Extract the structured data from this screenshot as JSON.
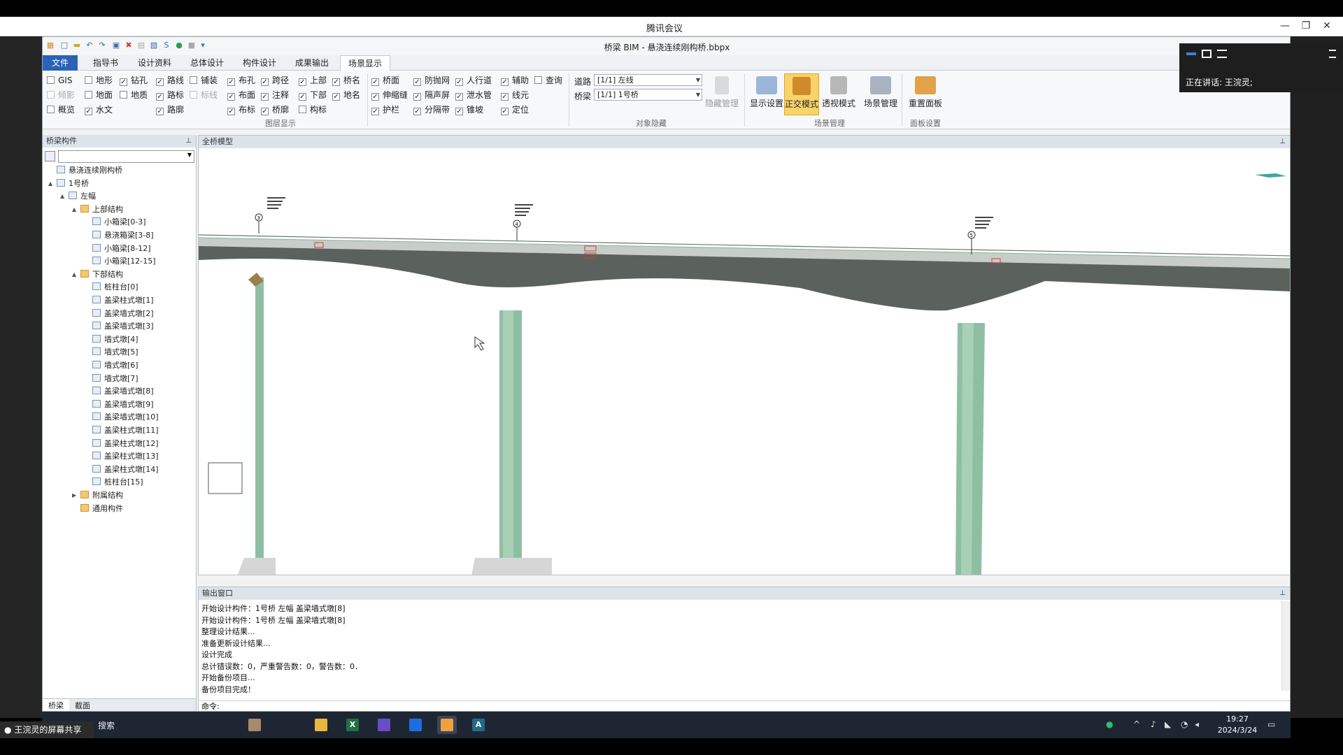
{
  "meeting": {
    "title": "腾讯会议",
    "speaker_label": "正在讲话:",
    "speaker_name": "王浣灵;",
    "share_text": "王浣灵的屏幕共享"
  },
  "app": {
    "doc_title": "桥梁 BIM - 悬浇连续刚构桥.bbpx",
    "tabs": [
      "文件",
      "指导书",
      "设计资料",
      "总体设计",
      "构件设计",
      "成果输出",
      "场景显示"
    ],
    "active_tab": "场景显示"
  },
  "ribbon": {
    "layer_group_label": "图层显示",
    "object_hide_label": "对象隐藏",
    "scene_manage_label": "场景管理",
    "panel_settings_label": "面板设置",
    "checkboxes": {
      "gis": "GIS",
      "tilt": "倾影",
      "overview": "概览",
      "terrain": "地形",
      "ground": "地面",
      "hydro": "水文",
      "drill": "钻孔",
      "geology": "地质",
      "route": "路线",
      "road_mark": "路标",
      "road_outline": "路廓",
      "paving": "铺装",
      "mark_line": "标线",
      "layout_hole": "布孔",
      "layout_face": "布面",
      "layout_mark": "布标",
      "span": "跨径",
      "annotation": "注释",
      "bridge_outline": "桥廓",
      "upper": "上部",
      "lower": "下部",
      "component_mark": "构标",
      "bridge_name": "桥名",
      "place_name": "地名",
      "deck": "桥面",
      "expansion": "伸缩缝",
      "guardrail": "护栏",
      "anti_throw": "防抛网",
      "sound_barrier": "隔声屏",
      "separator": "分隔带",
      "sidewalk": "人行道",
      "drain": "泄水管",
      "slope": "锥坡",
      "aux": "辅助",
      "line_elem": "线元",
      "position": "定位",
      "query": "查询"
    },
    "road_label": "道路",
    "road_value": "[1/1] 左线",
    "bridge_label": "桥梁",
    "bridge_value": "[1/1] 1号桥",
    "buttons": {
      "hide_manage": "隐藏管理",
      "display_settings": "显示设置",
      "ortho_mode": "正交模式",
      "persp_mode": "透视模式",
      "scene_manage": "场景管理",
      "reset_panel": "重置面板"
    }
  },
  "left_panel": {
    "title": "桥梁构件",
    "tree": [
      {
        "label": "悬浇连续刚构桥",
        "level": 0,
        "kind": "doc"
      },
      {
        "label": "1号桥",
        "level": 0,
        "kind": "bridge",
        "exp": "▲"
      },
      {
        "label": "左幅",
        "level": 1,
        "kind": "span",
        "exp": "▲"
      },
      {
        "label": "上部结构",
        "level": 2,
        "kind": "folder",
        "exp": "▲"
      },
      {
        "label": "小箱梁[0-3]",
        "level": 3,
        "kind": "item"
      },
      {
        "label": "悬浇箱梁[3-8]",
        "level": 3,
        "kind": "item"
      },
      {
        "label": "小箱梁[8-12]",
        "level": 3,
        "kind": "item"
      },
      {
        "label": "小箱梁[12-15]",
        "level": 3,
        "kind": "item"
      },
      {
        "label": "下部结构",
        "level": 2,
        "kind": "folder",
        "exp": "▲"
      },
      {
        "label": "桩柱台[0]",
        "level": 3,
        "kind": "item"
      },
      {
        "label": "盖梁柱式墩[1]",
        "level": 3,
        "kind": "item"
      },
      {
        "label": "盖梁墙式墩[2]",
        "level": 3,
        "kind": "item"
      },
      {
        "label": "盖梁墙式墩[3]",
        "level": 3,
        "kind": "item"
      },
      {
        "label": "墙式墩[4]",
        "level": 3,
        "kind": "item"
      },
      {
        "label": "墙式墩[5]",
        "level": 3,
        "kind": "item"
      },
      {
        "label": "墙式墩[6]",
        "level": 3,
        "kind": "item"
      },
      {
        "label": "墙式墩[7]",
        "level": 3,
        "kind": "item"
      },
      {
        "label": "盖梁墙式墩[8]",
        "level": 3,
        "kind": "item"
      },
      {
        "label": "盖梁墙式墩[9]",
        "level": 3,
        "kind": "item"
      },
      {
        "label": "盖梁墙式墩[10]",
        "level": 3,
        "kind": "item"
      },
      {
        "label": "盖梁柱式墩[11]",
        "level": 3,
        "kind": "item"
      },
      {
        "label": "盖梁柱式墩[12]",
        "level": 3,
        "kind": "item"
      },
      {
        "label": "盖梁柱式墩[13]",
        "level": 3,
        "kind": "item"
      },
      {
        "label": "盖梁柱式墩[14]",
        "level": 3,
        "kind": "item"
      },
      {
        "label": "桩柱台[15]",
        "level": 3,
        "kind": "item"
      },
      {
        "label": "附属结构",
        "level": 2,
        "kind": "folder",
        "exp": "▶"
      },
      {
        "label": "通用构件",
        "level": 2,
        "kind": "folder"
      }
    ],
    "bottom_tabs": [
      "桥梁",
      "截面"
    ]
  },
  "viewport": {
    "title": "全桥模型",
    "pier_labels": [
      "3",
      "4",
      "5"
    ]
  },
  "output": {
    "title": "输出窗口",
    "lines": [
      "开始设计构件：1号桥  左幅  盖梁墙式墩[8]",
      "开始设计构件：1号桥  左幅  盖梁墙式墩[8]",
      "整理设计结果...",
      "准备更新设计结果...",
      "设计完成",
      "总计错误数：0，严重警告数：0，警告数：0．",
      "开始备份项目...",
      "备份项目完成！"
    ],
    "command_label": "命令:"
  },
  "taskbar": {
    "search_label": "搜索",
    "time": "19:27",
    "date": "2024/3/24"
  },
  "colors": {
    "file_tab": "#2a62b8",
    "active_button": "#f7d36a",
    "taskbar": "#1f2633",
    "pier": "#8fbfa3",
    "girder": "#5b615d"
  }
}
